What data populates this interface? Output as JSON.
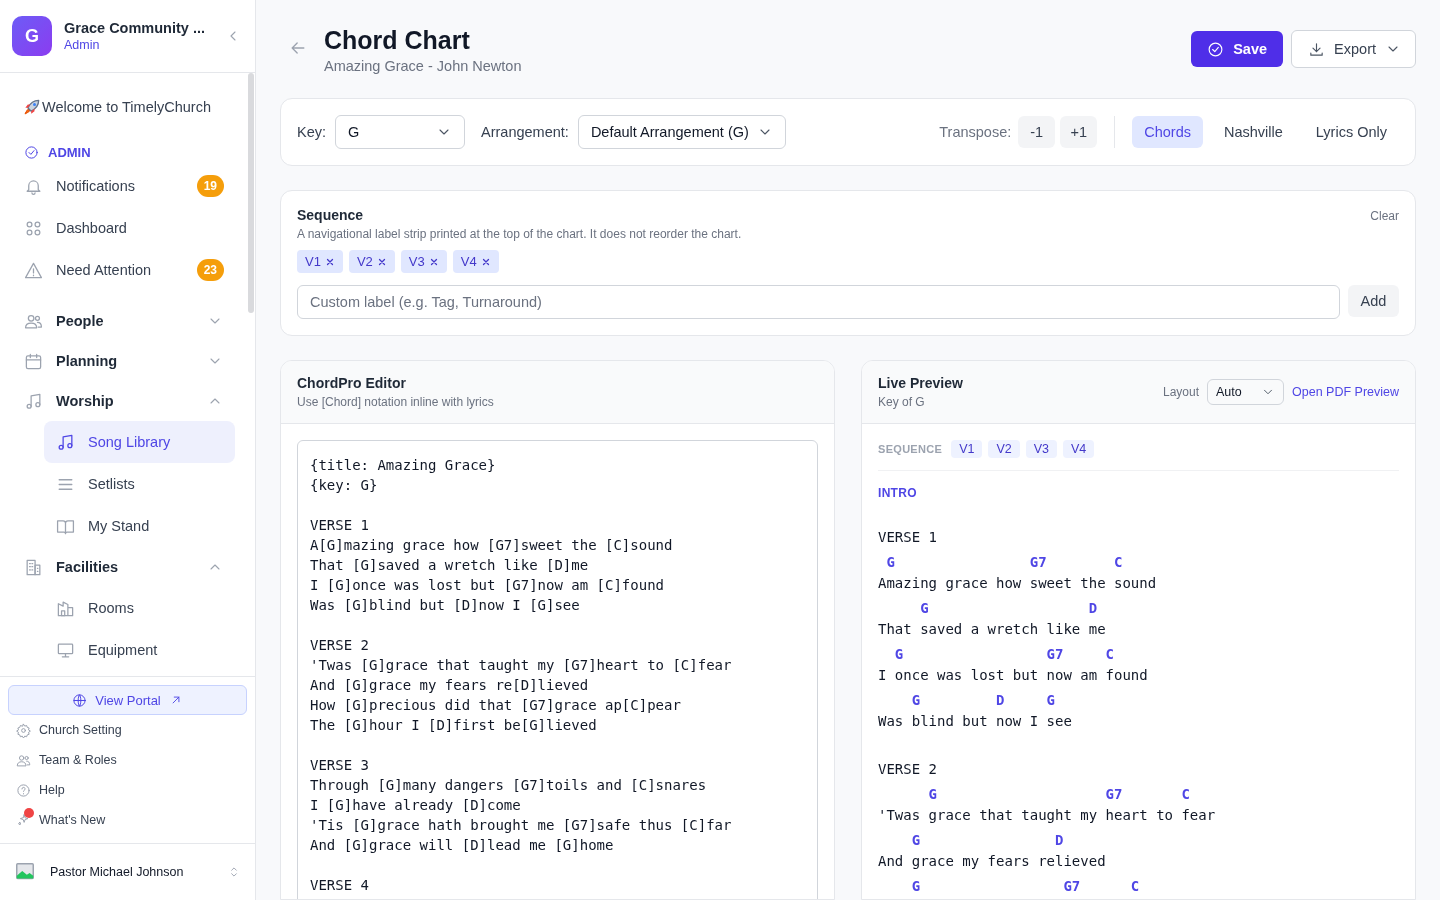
{
  "sidebar": {
    "org": {
      "initial": "G",
      "name": "Grace Community ...",
      "role": "Admin"
    },
    "welcome": "Welcome to TimelyChurch",
    "section": "ADMIN",
    "nav": [
      {
        "kind": "item",
        "label": "Notifications",
        "badge": "19",
        "selected": false
      },
      {
        "kind": "item",
        "label": "Dashboard",
        "selected": false
      },
      {
        "kind": "item",
        "label": "Need Attention",
        "badge": "23",
        "selected": false
      },
      {
        "kind": "group",
        "label": "People",
        "expanded": false
      },
      {
        "kind": "group",
        "label": "Planning",
        "expanded": false
      },
      {
        "kind": "group",
        "label": "Worship",
        "expanded": true,
        "children": [
          {
            "label": "Song Library",
            "selected": true
          },
          {
            "label": "Setlists",
            "selected": false
          },
          {
            "label": "My Stand",
            "selected": false
          }
        ]
      },
      {
        "kind": "group",
        "label": "Facilities",
        "expanded": true,
        "children": [
          {
            "label": "Rooms",
            "selected": false
          },
          {
            "label": "Equipment",
            "selected": false
          }
        ]
      }
    ],
    "portal_button": "View Portal",
    "footer_links": [
      {
        "label": "Church Setting",
        "unread": false
      },
      {
        "label": "Team & Roles",
        "unread": false
      },
      {
        "label": "Help",
        "unread": false
      },
      {
        "label": "What's New",
        "unread": true
      }
    ],
    "user": {
      "name": "Pastor Michael Johnson"
    }
  },
  "header": {
    "title": "Chord Chart",
    "subtitle": "Amazing Grace - John Newton",
    "save": "Save",
    "export": "Export"
  },
  "toolbar": {
    "key_label": "Key:",
    "key": "G",
    "arrangement_label": "Arrangement:",
    "arrangement": "Default Arrangement (G)",
    "transpose_label": "Transpose:",
    "transpose_buttons": [
      "-1",
      "+1"
    ],
    "modes": [
      {
        "label": "Chords",
        "selected": true
      },
      {
        "label": "Nashville",
        "selected": false
      },
      {
        "label": "Lyrics Only",
        "selected": false
      }
    ]
  },
  "sequence": {
    "title": "Sequence",
    "description": "A navigational label strip printed at the top of the chart. It does not reorder the chart.",
    "clear": "Clear",
    "chips": [
      "V1",
      "V2",
      "V3",
      "V4"
    ],
    "placeholder": "Custom label (e.g. Tag, Turnaround)",
    "add": "Add"
  },
  "editor": {
    "title": "ChordPro Editor",
    "subtitle": "Use [Chord] notation inline with lyrics",
    "value": "{title: Amazing Grace}\n{key: G}\n\nVERSE 1\nA[G]mazing grace how [G7]sweet the [C]sound\nThat [G]saved a wretch like [D]me\nI [G]once was lost but [G7]now am [C]found\nWas [G]blind but [D]now I [G]see\n\nVERSE 2\n'Twas [G]grace that taught my [G7]heart to [C]fear\nAnd [G]grace my fears re[D]lieved\nHow [G]precious did that [G7]grace ap[C]pear\nThe [G]hour I [D]first be[G]lieved\n\nVERSE 3\nThrough [G]many dangers [G7]toils and [C]snares\nI [G]have already [D]come\n'Tis [G]grace hath brought me [G7]safe thus [C]far\nAnd [G]grace will [D]lead me [G]home\n\nVERSE 4"
  },
  "preview": {
    "title": "Live Preview",
    "subtitle": "Key of G",
    "layout_label": "Layout",
    "layout": "Auto",
    "pdf_link": "Open PDF Preview",
    "sequence_label": "SEQUENCE",
    "sequence": [
      "V1",
      "V2",
      "V3",
      "V4"
    ],
    "sections": [
      {
        "kind": "marker",
        "label": "INTRO"
      },
      {
        "kind": "verse",
        "label": "VERSE 1",
        "lines": [
          {
            "chords": " G                G7        C",
            "lyric": "Amazing grace how sweet the sound"
          },
          {
            "chords": "     G                   D",
            "lyric": "That saved a wretch like me"
          },
          {
            "chords": "  G                 G7     C",
            "lyric": "I once was lost but now am found"
          },
          {
            "chords": "    G         D     G",
            "lyric": "Was blind but now I see"
          }
        ]
      },
      {
        "kind": "verse",
        "label": "VERSE 2",
        "lines": [
          {
            "chords": "      G                    G7       C",
            "lyric": "'Twas grace that taught my heart to fear"
          },
          {
            "chords": "    G                D",
            "lyric": "And grace my fears relieved"
          },
          {
            "chords": "    G                 G7      C"
          }
        ]
      }
    ]
  }
}
